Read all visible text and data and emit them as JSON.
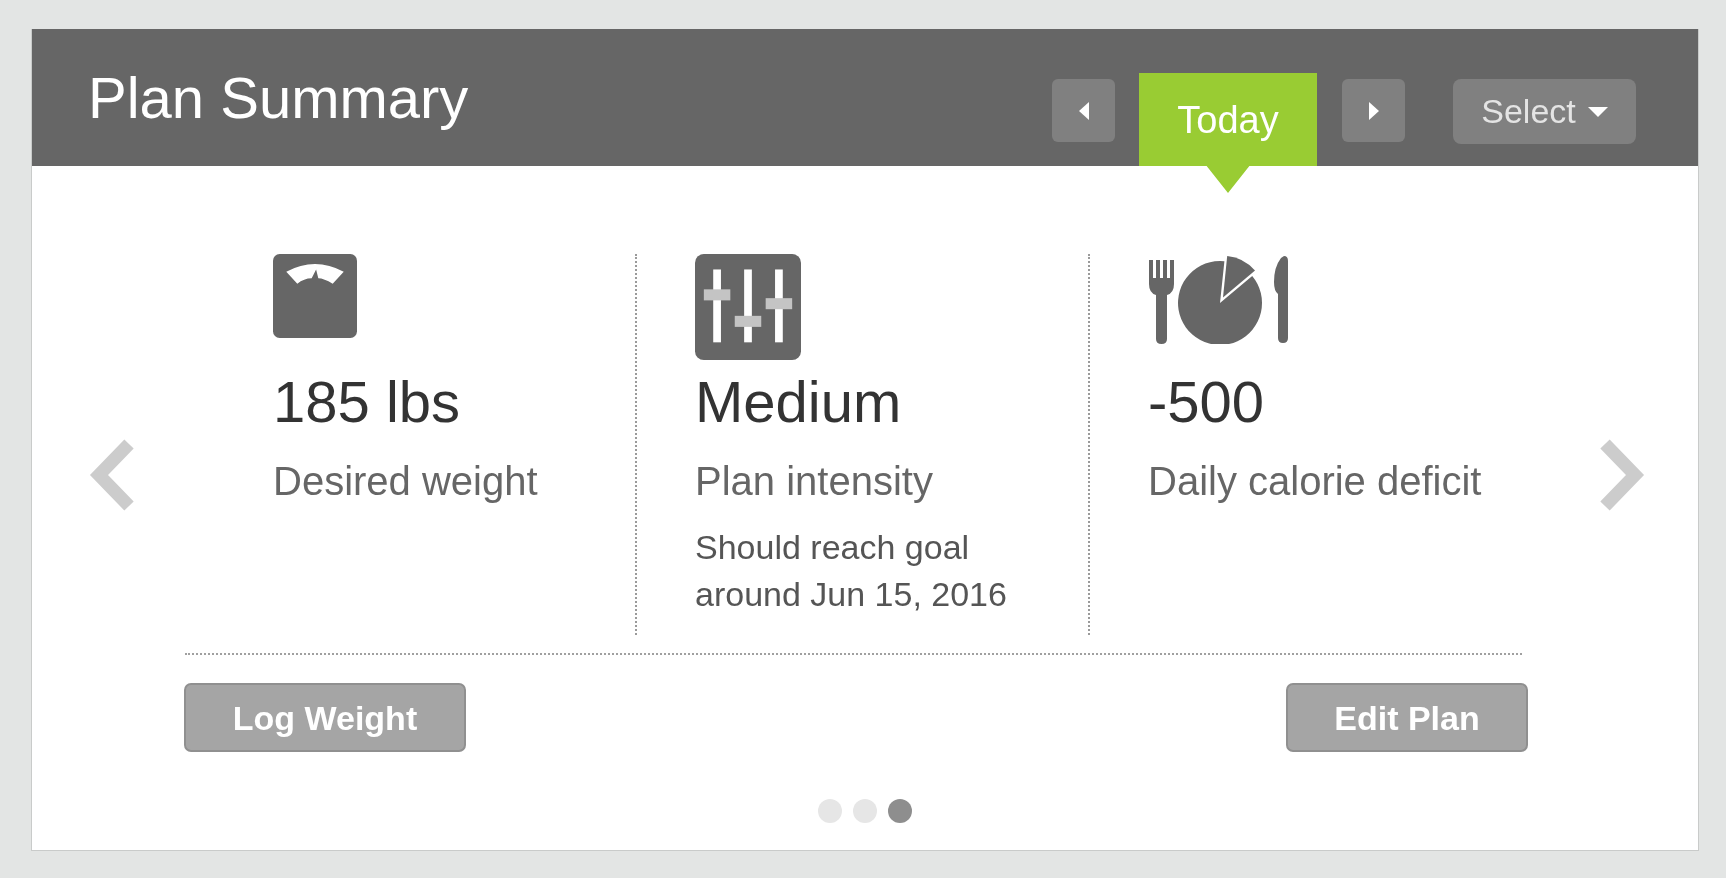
{
  "panel": {
    "title": "Plan Summary"
  },
  "date_tabs": [
    {
      "label": "Today",
      "selected": true
    }
  ],
  "select": {
    "label": "Select"
  },
  "stats": [
    {
      "kind": "scale",
      "value": "185 lbs",
      "label": "Desired weight"
    },
    {
      "kind": "sliders",
      "value": "Medium",
      "label": "Plan intensity",
      "note": "Should reach goal around Jun 15, 2016"
    },
    {
      "kind": "meal",
      "value": "-500",
      "label": "Daily calorie deficit"
    }
  ],
  "actions": [
    {
      "label": "Log Weight"
    },
    {
      "label": "Edit Plan"
    }
  ],
  "pager": [
    {
      "selected": false
    },
    {
      "selected": false
    },
    {
      "selected": true
    }
  ]
}
